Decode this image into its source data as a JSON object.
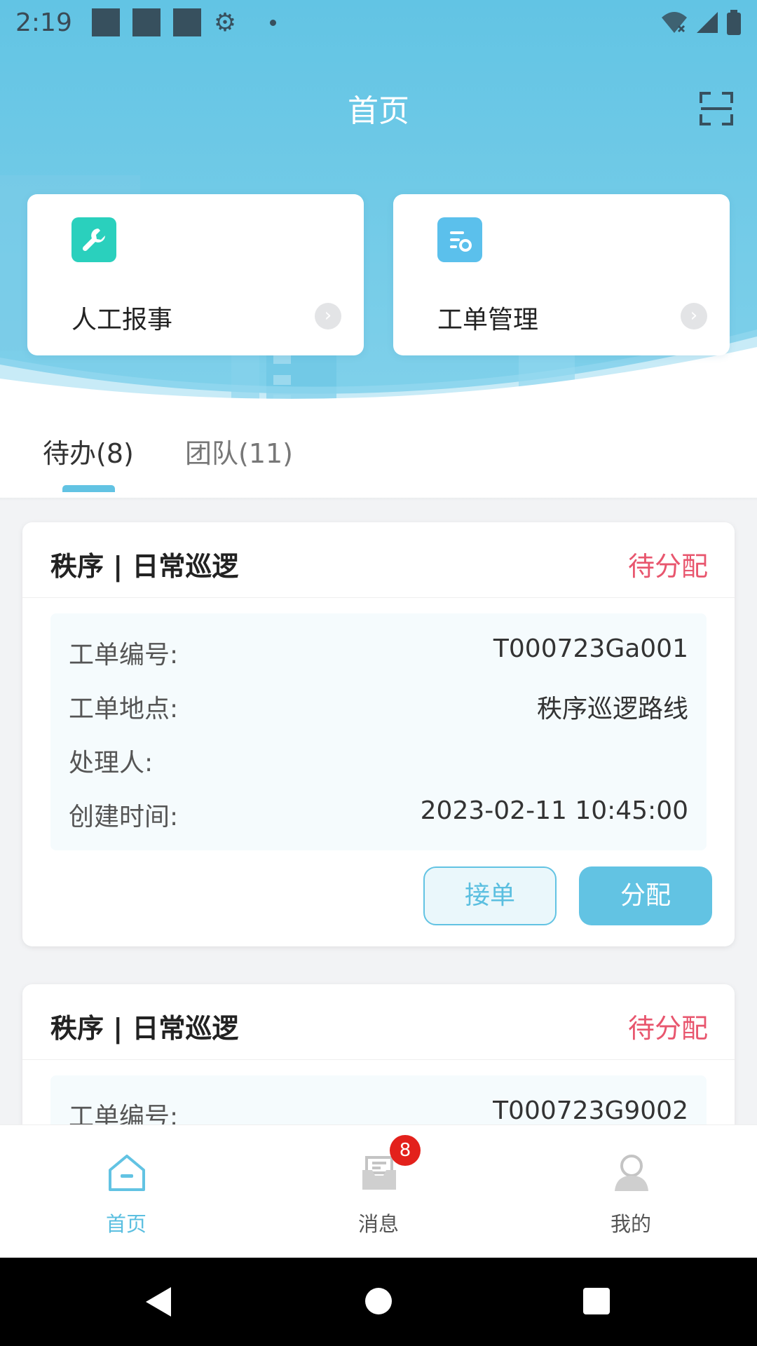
{
  "status_bar": {
    "time": "2:19"
  },
  "header": {
    "title": "首页"
  },
  "quick_actions": [
    {
      "label": "人工报事",
      "icon": "wrench-icon",
      "color": "#2ad0bd"
    },
    {
      "label": "工单管理",
      "icon": "document-settings-icon",
      "color": "#5bc0ec"
    }
  ],
  "tabs": [
    {
      "label": "待办(8)",
      "active": true
    },
    {
      "label": "团队(11)",
      "active": false
    }
  ],
  "tickets": [
    {
      "title": "秩序 | 日常巡逻",
      "status": "待分配",
      "fields": [
        {
          "key": "工单编号:",
          "value": "T000723Ga001"
        },
        {
          "key": "工单地点:",
          "value": "秩序巡逻路线"
        },
        {
          "key": "处理人:",
          "value": ""
        },
        {
          "key": "创建时间:",
          "value": "2023-02-11 10:45:00"
        }
      ],
      "actions": {
        "accept": "接单",
        "assign": "分配"
      }
    },
    {
      "title": "秩序 | 日常巡逻",
      "status": "待分配",
      "fields": [
        {
          "key": "工单编号:",
          "value": "T000723G9002"
        }
      ]
    }
  ],
  "bottom_nav": [
    {
      "label": "首页",
      "icon": "home-icon",
      "active": true
    },
    {
      "label": "消息",
      "icon": "inbox-icon",
      "active": false,
      "badge": "8"
    },
    {
      "label": "我的",
      "icon": "user-icon",
      "active": false
    }
  ],
  "colors": {
    "accent": "#62c3e3",
    "status_pending": "#e8566e",
    "badge": "#e3211c"
  }
}
